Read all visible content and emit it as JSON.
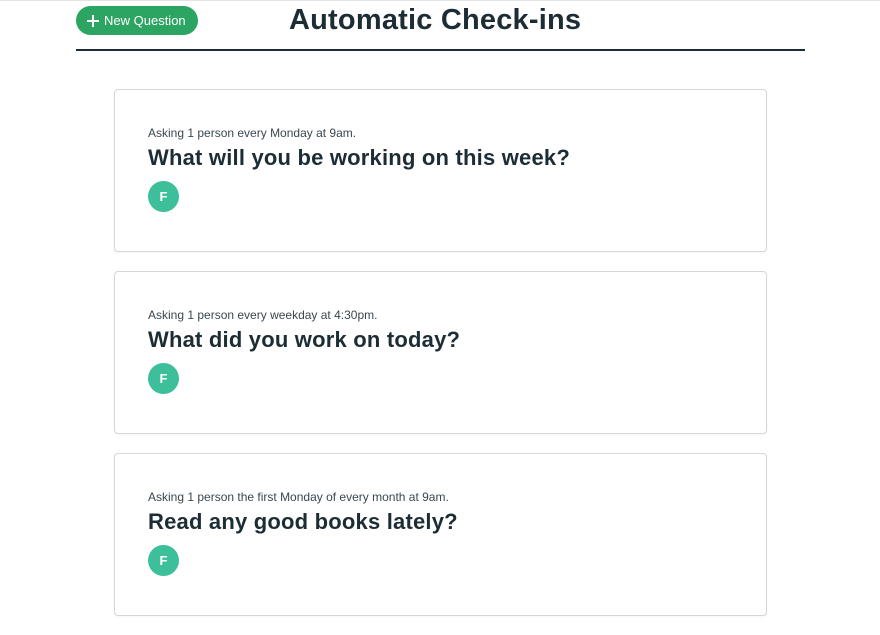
{
  "header": {
    "new_question_label": "New Question",
    "title": "Automatic Check-ins"
  },
  "questions": [
    {
      "schedule": "Asking 1 person every Monday at 9am.",
      "title": "What will you be working on this week?",
      "participants": [
        {
          "initial": "F"
        }
      ]
    },
    {
      "schedule": "Asking 1 person every weekday at 4:30pm.",
      "title": "What did you work on today?",
      "participants": [
        {
          "initial": "F"
        }
      ]
    },
    {
      "schedule": "Asking 1 person the first Monday of every month at 9am.",
      "title": "Read any good books lately?",
      "participants": [
        {
          "initial": "F"
        }
      ]
    }
  ],
  "colors": {
    "accent_green": "#2da562",
    "avatar_teal": "#3cbf9a",
    "text_dark": "#1d2d35"
  },
  "icons": {
    "new_question": "plus-icon"
  }
}
